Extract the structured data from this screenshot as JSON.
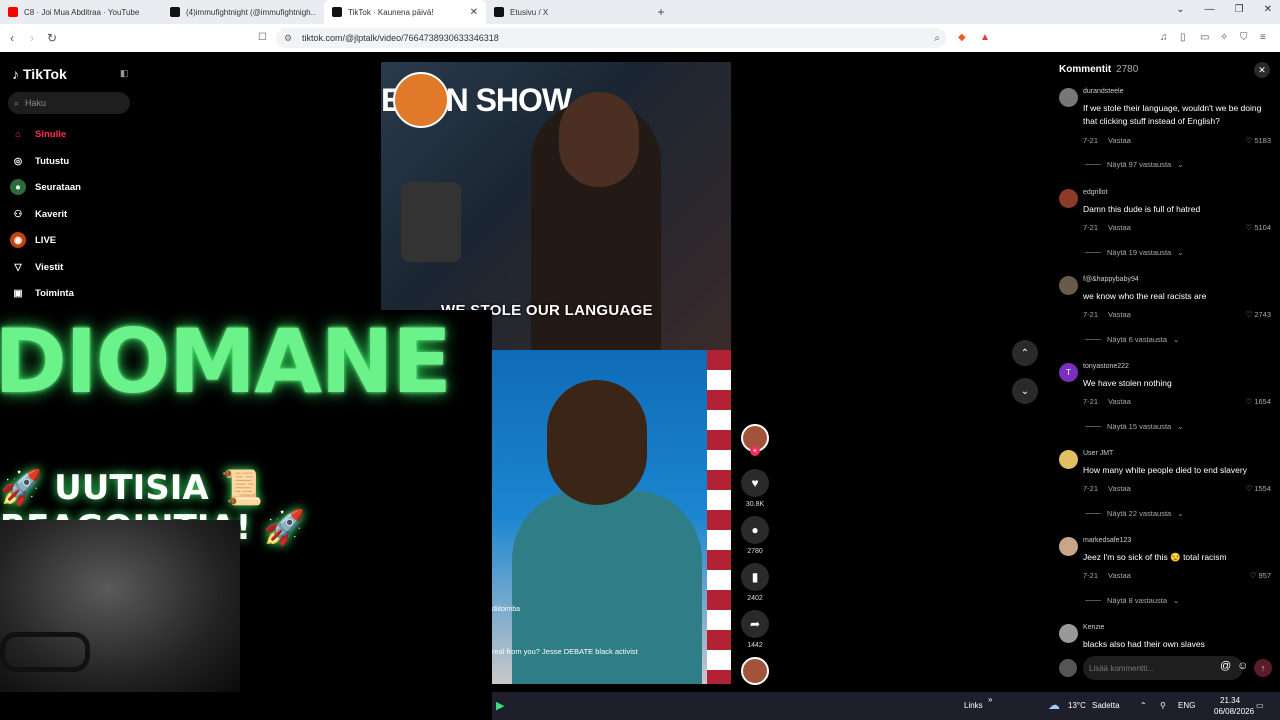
{
  "browser": {
    "tabs": [
      {
        "title": "C8 · Joi Mua Abditraa · YouTube",
        "color": "#ff0000"
      },
      {
        "title": "(4)immufightnight (@immufightnigh...",
        "color": "#111111"
      },
      {
        "title": "TikTok · Kaunena päivä!",
        "color": "#111111",
        "active": true
      },
      {
        "title": "Etusivu / X",
        "color": "#111111"
      }
    ],
    "new_tab": "+",
    "url": "tiktok.com/@jlptalk/video/7664738930633346318"
  },
  "sidebar": {
    "logo": "TikTok",
    "search_placeholder": "Haku",
    "items": [
      {
        "label": "Sinulle",
        "icon": "home-icon",
        "active": true
      },
      {
        "label": "Tutustu",
        "icon": "compass-icon"
      },
      {
        "label": "Seurataan",
        "icon": "following-icon"
      },
      {
        "label": "Kaverit",
        "icon": "friends-icon"
      },
      {
        "label": "LIVE",
        "icon": "live-icon"
      },
      {
        "label": "Viestit",
        "icon": "messages-icon"
      },
      {
        "label": "Toiminta",
        "icon": "activity-icon"
      }
    ]
  },
  "video": {
    "caption": "WE STOLE OUR LANGUAGE",
    "banner": "ESON SHOW",
    "author": "diitoimba",
    "description": "real from you? Jesse DEBATE black activist"
  },
  "overlay": {
    "big_text": "DIOMANE",
    "sub_text": "🚀 UUTISIA 📜 REAGOINTIA! 🚀"
  },
  "actions": {
    "likes": "30.8K",
    "comments": "2780",
    "saves": "2402",
    "shares": "1442"
  },
  "comments_panel": {
    "title": "Kommentit",
    "count": "2780",
    "input_placeholder": "Lisää kommentti...",
    "items": [
      {
        "user": "durandsteele",
        "text": "If we stole their language, wouldn't we be doing that clicking stuff instead of English?",
        "date": "7-21",
        "reply": "Vastaa",
        "likes": "5183",
        "more": "Näytä 97 vastausta",
        "avatar": "#777777"
      },
      {
        "user": "edgrillot",
        "text": "Damn this dude is full of hatred",
        "date": "7-21",
        "reply": "Vastaa",
        "likes": "5104",
        "more": "Näytä 19 vastausta",
        "avatar": "#8a3b2a"
      },
      {
        "user": "f@&happybaby94",
        "text": "we know who the real racists are",
        "date": "7-21",
        "reply": "Vastaa",
        "likes": "2743",
        "more": "Näytä 6 vastausta",
        "avatar": "#6a5a4a"
      },
      {
        "user": "tonyastone222",
        "text": "We have stolen nothing",
        "date": "7-21",
        "reply": "Vastaa",
        "likes": "1654",
        "more": "Näytä 15 vastausta",
        "avatar": "#7b2fbf",
        "initial": "T"
      },
      {
        "user": "User JMT",
        "text": "How many white people died to end slavery",
        "date": "7-21",
        "reply": "Vastaa",
        "likes": "1554",
        "more": "Näytä 22 vastausta",
        "avatar": "#e0c060"
      },
      {
        "user": "markedsafe123",
        "text": "Jeez I'm so sick of this 😒 total racism",
        "date": "7-21",
        "reply": "Vastaa",
        "likes": "957",
        "more": "Näytä 8 vastausta",
        "avatar": "#c9a58a"
      },
      {
        "user": "Kenzie",
        "text": "blacks also had their own slaves",
        "avatar": "#999999"
      }
    ]
  },
  "taskbar": {
    "links": "Links",
    "temp": "13°C",
    "weather": "Sadetta",
    "lang": "ENG",
    "time": "21.34",
    "date": "06/08/2026"
  }
}
